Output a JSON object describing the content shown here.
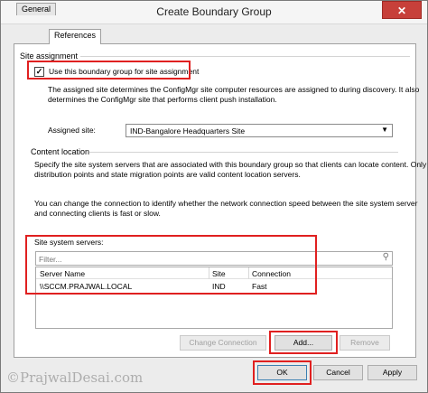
{
  "window": {
    "title": "Create Boundary Group",
    "close_glyph": "✕"
  },
  "tabs": [
    {
      "label": "General",
      "active": false
    },
    {
      "label": "References",
      "active": true
    }
  ],
  "site_assignment": {
    "group_label": "Site assignment",
    "checkbox_label": "Use this boundary group for site assignment",
    "checked": true,
    "description_line1": "The assigned site determines the ConfigMgr site computer resources are assigned to during discovery. It also",
    "description_line2": "determines the ConfigMgr site that performs client push installation.",
    "assigned_site_label": "Assigned site:",
    "assigned_site_value": "IND-Bangalore Headquarters Site"
  },
  "content_location": {
    "group_label": "Content location",
    "desc1_line1": "Specify the site system servers that are associated with this boundary group so that clients can locate content. Only",
    "desc1_line2": "distribution points and state migration points are valid content location servers.",
    "desc2_line1": "You can change the connection to identify whether the network connection speed between the site system server",
    "desc2_line2": "and connecting clients is fast or slow.",
    "servers_label": "Site system servers:",
    "filter_placeholder": "Filter...",
    "columns": [
      "Server Name",
      "Site",
      "Connection"
    ],
    "rows": [
      {
        "server": "\\\\SCCM.PRAJWAL.LOCAL",
        "site": "IND",
        "connection": "Fast"
      }
    ],
    "buttons": {
      "change_connection": "Change Connection",
      "add": "Add...",
      "remove": "Remove"
    }
  },
  "footer": {
    "ok": "OK",
    "cancel": "Cancel",
    "apply": "Apply"
  },
  "watermark": "©PrajwalDesai.com",
  "colors": {
    "highlight_box": "#e02020"
  }
}
